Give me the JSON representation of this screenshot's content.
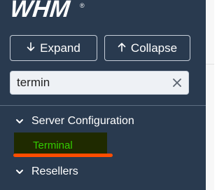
{
  "brand": {
    "logo_text": "WHM",
    "registered_mark": "®"
  },
  "toolbar": {
    "expand_label": "Expand",
    "collapse_label": "Collapse"
  },
  "search": {
    "value": "termin"
  },
  "nav": {
    "sections": [
      {
        "label": "Server Configuration",
        "items": [
          {
            "label": "Terminal"
          }
        ]
      },
      {
        "label": "Resellers"
      }
    ]
  },
  "colors": {
    "sidebar_bg": "#293a4f",
    "link_highlight": "#33cc00",
    "annotation_underline": "#ff4d00"
  }
}
